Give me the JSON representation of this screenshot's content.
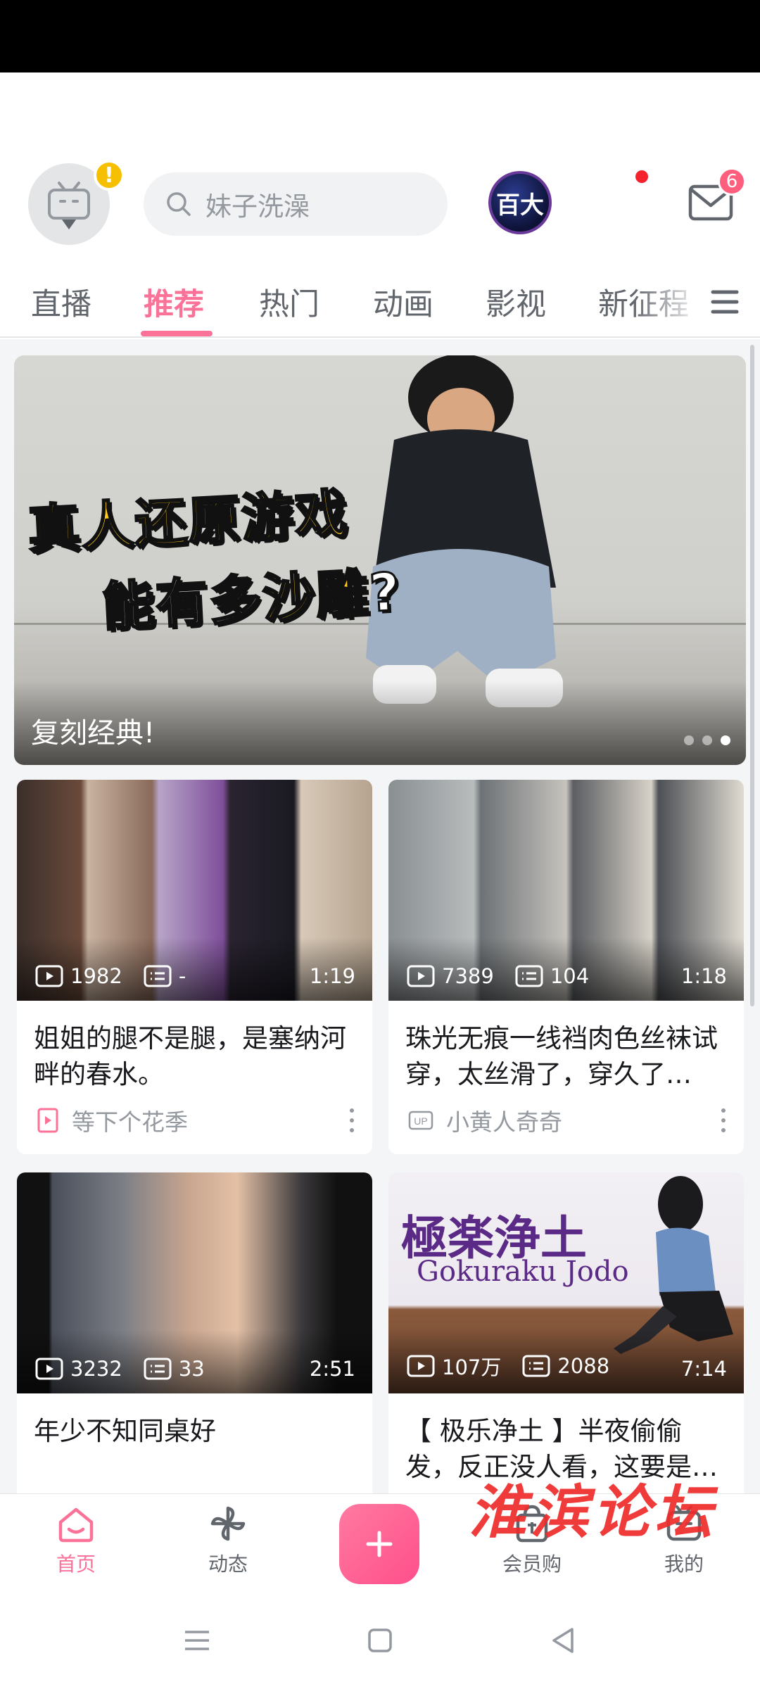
{
  "header": {
    "avatar_badge": "!",
    "search_placeholder": "妹子洗澡",
    "game_badge": "百大",
    "mail_count": "6"
  },
  "tabs": [
    {
      "label": "直播",
      "active": false
    },
    {
      "label": "推荐",
      "active": true
    },
    {
      "label": "热门",
      "active": false
    },
    {
      "label": "动画",
      "active": false
    },
    {
      "label": "影视",
      "active": false
    },
    {
      "label": "新征程",
      "active": false
    }
  ],
  "banner": {
    "headline_line1": "真人还原游戏",
    "headline_line2a": "能有多",
    "headline_line2b": "沙雕",
    "headline_line2c": "?",
    "caption": "复刻经典!",
    "dots_total": 3,
    "dots_active_index": 2
  },
  "cards": [
    {
      "views": "1982",
      "danmaku": "-",
      "duration": "1:19",
      "title": "姐姐的腿不是腿，是塞纳河畔的春水。",
      "author": "等下个花季",
      "author_icon": "page-icon"
    },
    {
      "views": "7389",
      "danmaku": "104",
      "duration": "1:18",
      "title": "珠光无痕一线裆肉色丝袜试穿，太丝滑了，穿久了…",
      "author": "小黄人奇奇",
      "author_icon": "up-icon"
    },
    {
      "views": "3232",
      "danmaku": "33",
      "duration": "2:51",
      "title": "年少不知同桌好"
    },
    {
      "views": "107万",
      "danmaku": "2088",
      "duration": "7:14",
      "title": "【 极乐净土 】半夜偷偷发，反正没人看，这要是…",
      "thumb_title": "極楽浄土",
      "thumb_subtitle": "Gokuraku Jodo"
    }
  ],
  "bottom_nav": {
    "home": "首页",
    "dynamic": "动态",
    "shop": "会员购",
    "mine": "我的"
  },
  "watermark": "淮滨论坛",
  "colors": {
    "accent": "#fb7299",
    "text": "#18191c",
    "muted": "#9499a0",
    "feed_bg": "#f4f5f7"
  }
}
